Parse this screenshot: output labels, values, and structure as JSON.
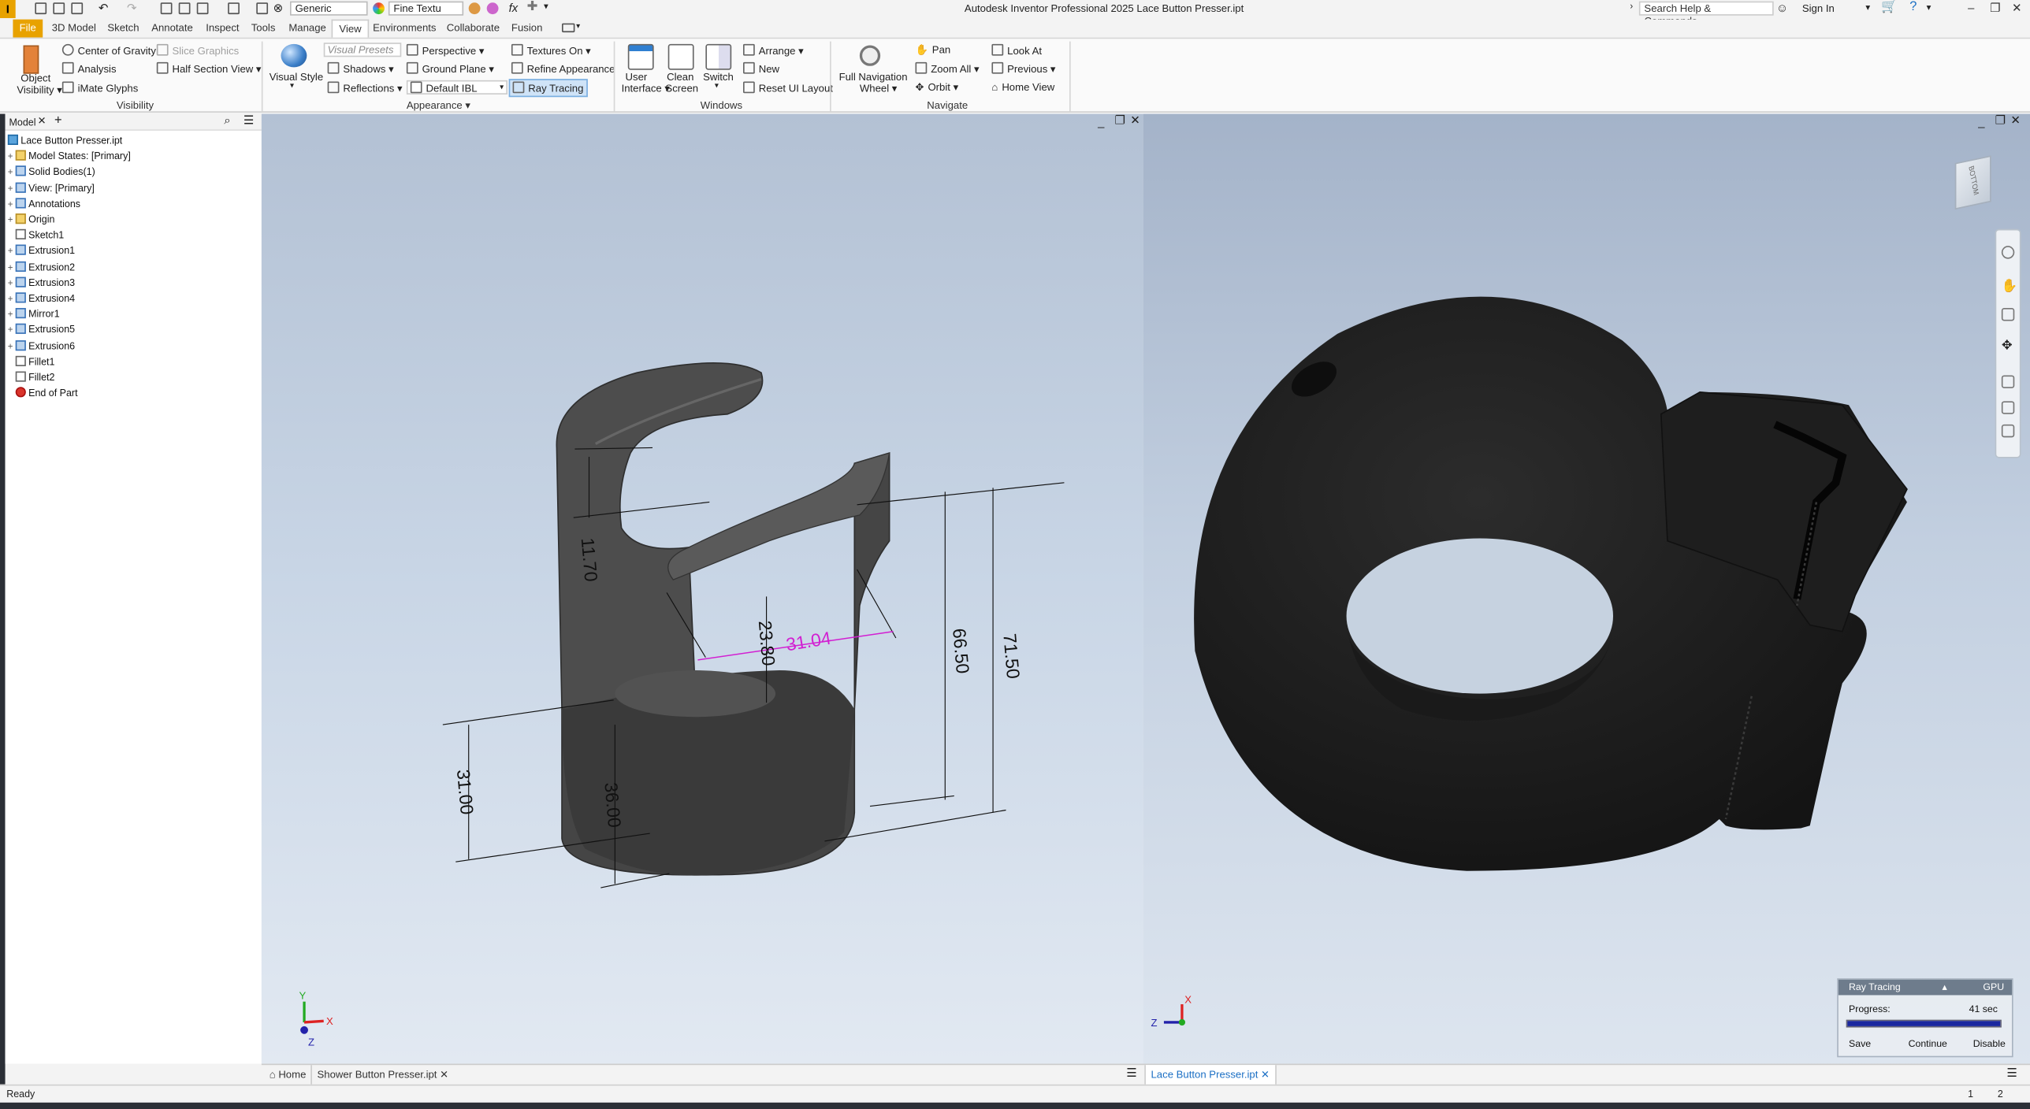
{
  "titlebar": {
    "app_letter": "I",
    "title": "Autodesk Inventor Professional 2025    Lace Button Presser.ipt",
    "material_select": "Generic",
    "appearance_select": "Fine Textu",
    "fx_label": "fx",
    "search_placeholder": "Search Help & Commands...",
    "sign_in": "Sign In"
  },
  "menu": {
    "tabs": [
      "File",
      "3D Model",
      "Sketch",
      "Annotate",
      "Inspect",
      "Tools",
      "Manage",
      "View",
      "Environments",
      "Collaborate",
      "Fusion"
    ],
    "active_tab": "View"
  },
  "ribbon": {
    "visibility": {
      "object_visibility": "Object Visibility",
      "center_of_gravity": "Center of Gravity",
      "analysis": "Analysis",
      "imate_glyphs": "iMate Glyphs",
      "slice_graphics": "Slice Graphics",
      "half_section_view": "Half Section View",
      "panel": "Visibility"
    },
    "appearance": {
      "visual_style": "Visual Style",
      "visual_presets": "Visual Presets",
      "shadows": "Shadows",
      "reflections": "Reflections",
      "perspective": "Perspective",
      "ground_plane": "Ground Plane",
      "ibl": "Default IBL",
      "textures_on": "Textures On",
      "refine_appearance": "Refine Appearance",
      "ray_tracing": "Ray Tracing",
      "panel": "Appearance"
    },
    "windows": {
      "user_interface": "User Interface",
      "clean_screen": "Clean Screen",
      "switch": "Switch",
      "arrange": "Arrange",
      "new": "New",
      "reset_ui": "Reset UI Layout",
      "panel": "Windows"
    },
    "navigate": {
      "full_nav_wheel": "Full Navigation Wheel",
      "pan": "Pan",
      "zoom_all": "Zoom All",
      "orbit": "Orbit",
      "look_at": "Look At",
      "previous": "Previous",
      "home_view": "Home View",
      "panel": "Navigate"
    }
  },
  "browser": {
    "tab_label": "Model",
    "items": [
      {
        "label": "Lace Button Presser.ipt",
        "icon": "part-icon",
        "expand": ""
      },
      {
        "label": "Model States: [Primary]",
        "icon": "folder-icon",
        "expand": "+"
      },
      {
        "label": "Solid Bodies(1)",
        "icon": "solid-bodies-icon",
        "expand": "+"
      },
      {
        "label": "View: [Primary]",
        "icon": "view-icon",
        "expand": "+"
      },
      {
        "label": "Annotations",
        "icon": "annotations-icon",
        "expand": "+"
      },
      {
        "label": "Origin",
        "icon": "folder-icon",
        "expand": "+"
      },
      {
        "label": "Sketch1",
        "icon": "sketch-icon",
        "expand": ""
      },
      {
        "label": "Extrusion1",
        "icon": "extrusion-icon",
        "expand": "+"
      },
      {
        "label": "Extrusion2",
        "icon": "extrusion-icon",
        "expand": "+"
      },
      {
        "label": "Extrusion3",
        "icon": "extrusion-icon",
        "expand": "+"
      },
      {
        "label": "Extrusion4",
        "icon": "extrusion-icon",
        "expand": "+"
      },
      {
        "label": "Mirror1",
        "icon": "mirror-icon",
        "expand": "+"
      },
      {
        "label": "Extrusion5",
        "icon": "extrusion-icon",
        "expand": "+"
      },
      {
        "label": "Extrusion6",
        "icon": "extrusion-icon",
        "expand": "+"
      },
      {
        "label": "Fillet1",
        "icon": "fillet-icon",
        "expand": ""
      },
      {
        "label": "Fillet2",
        "icon": "fillet-icon",
        "expand": ""
      },
      {
        "label": "End of Part",
        "icon": "end-of-part-icon",
        "expand": ""
      }
    ]
  },
  "viewport_left": {
    "dimensions": {
      "d1": "11.70",
      "d2": "23.80",
      "d3": "31.04",
      "d4": "66.50",
      "d5": "71.50",
      "d6": "31.00",
      "d7": "36.00"
    },
    "axes": {
      "x": "X",
      "y": "Y",
      "z": "Z"
    }
  },
  "viewport_right": {
    "viewcube_label": "BOTTOM",
    "axes": {
      "x": "X",
      "z": "Z"
    }
  },
  "ray_tracing_panel": {
    "title": "Ray Tracing",
    "mode": "GPU",
    "progress_label": "Progress:",
    "time": "41 sec",
    "progress_fraction": 1.0,
    "save": "Save",
    "continue": "Continue",
    "disable": "Disable"
  },
  "doc_tabs": {
    "home": "Home",
    "tab1": "Shower Button Presser.ipt",
    "tab2": "Lace Button Presser.ipt"
  },
  "status": {
    "text": "Ready",
    "n1": "1",
    "n2": "2"
  },
  "colors": {
    "accent": "#e8a200",
    "dimension_highlight": "#d21fd2",
    "part_left": "#3c3c3c",
    "part_right": "#1c1c1c",
    "progress": "#1a28a0"
  }
}
